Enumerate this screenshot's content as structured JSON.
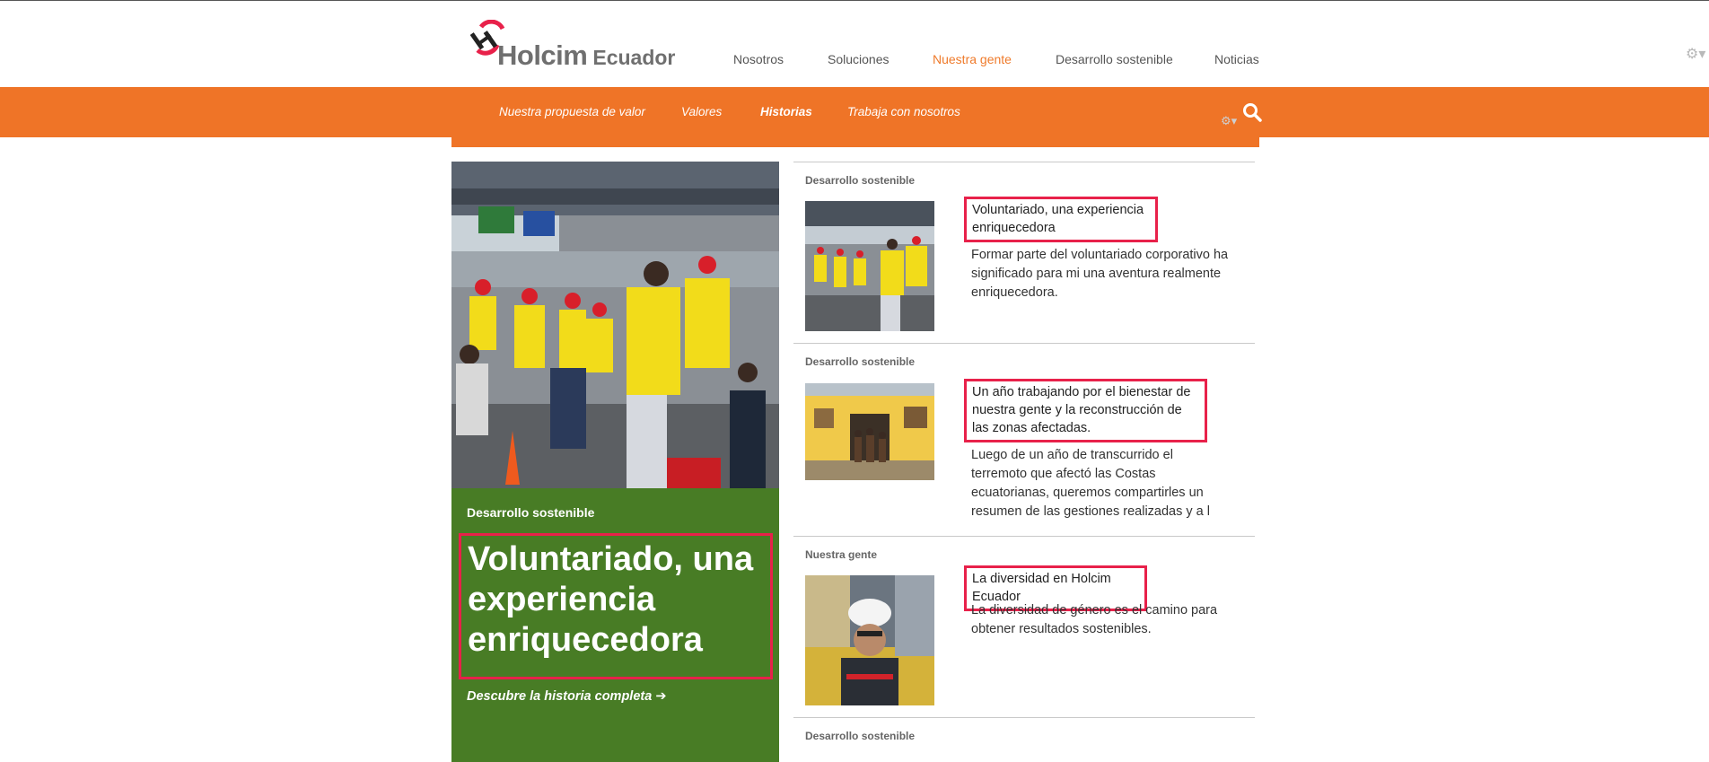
{
  "header": {
    "logo": {
      "brand": "Holcim",
      "country": "Ecuador"
    },
    "nav": [
      {
        "label": "Nosotros",
        "active": false
      },
      {
        "label": "Soluciones",
        "active": false
      },
      {
        "label": "Nuestra gente",
        "active": true
      },
      {
        "label": "Desarrollo sostenible",
        "active": false
      },
      {
        "label": "Noticias",
        "active": false
      }
    ],
    "settings_icon": "gear-icon"
  },
  "subnav": {
    "items": [
      {
        "label": "Nuestra propuesta de valor",
        "active": false
      },
      {
        "label": "Valores",
        "active": false
      },
      {
        "label": "Historias",
        "active": true
      },
      {
        "label": "Trabaja con nosotros",
        "active": false
      }
    ],
    "search_icon": "search-icon",
    "settings_icon": "gear-icon"
  },
  "featured": {
    "category": "Desarrollo sostenible",
    "title": "Voluntariado, una experiencia enriquecedora",
    "link_label": "Descubre la historia completa"
  },
  "articles": [
    {
      "category": "Desarrollo sostenible",
      "title": "Voluntariado, una experiencia enriquecedora",
      "description": "Formar parte del voluntariado corporativo ha significado para mi una aventura realmente enriquecedora."
    },
    {
      "category": "Desarrollo sostenible",
      "title": "Un año trabajando por el bienestar de nuestra gente y la reconstrucción de las zonas afectadas.",
      "description": "Luego de un año de transcurrido el terremoto que afectó las Costas ecuatorianas, queremos compartirles un resumen de las gestiones realizadas y a l"
    },
    {
      "category": "Nuestra gente",
      "title": "La diversidad en Holcim Ecuador",
      "description": "La diversidad de género es el camino para obtener resultados sostenibles."
    },
    {
      "category": "Desarrollo sostenible"
    }
  ],
  "colors": {
    "accent_orange": "#ef7427",
    "feature_green": "#487c25",
    "highlight_red": "#e8214a",
    "logo_gray": "#6f6f6f"
  }
}
